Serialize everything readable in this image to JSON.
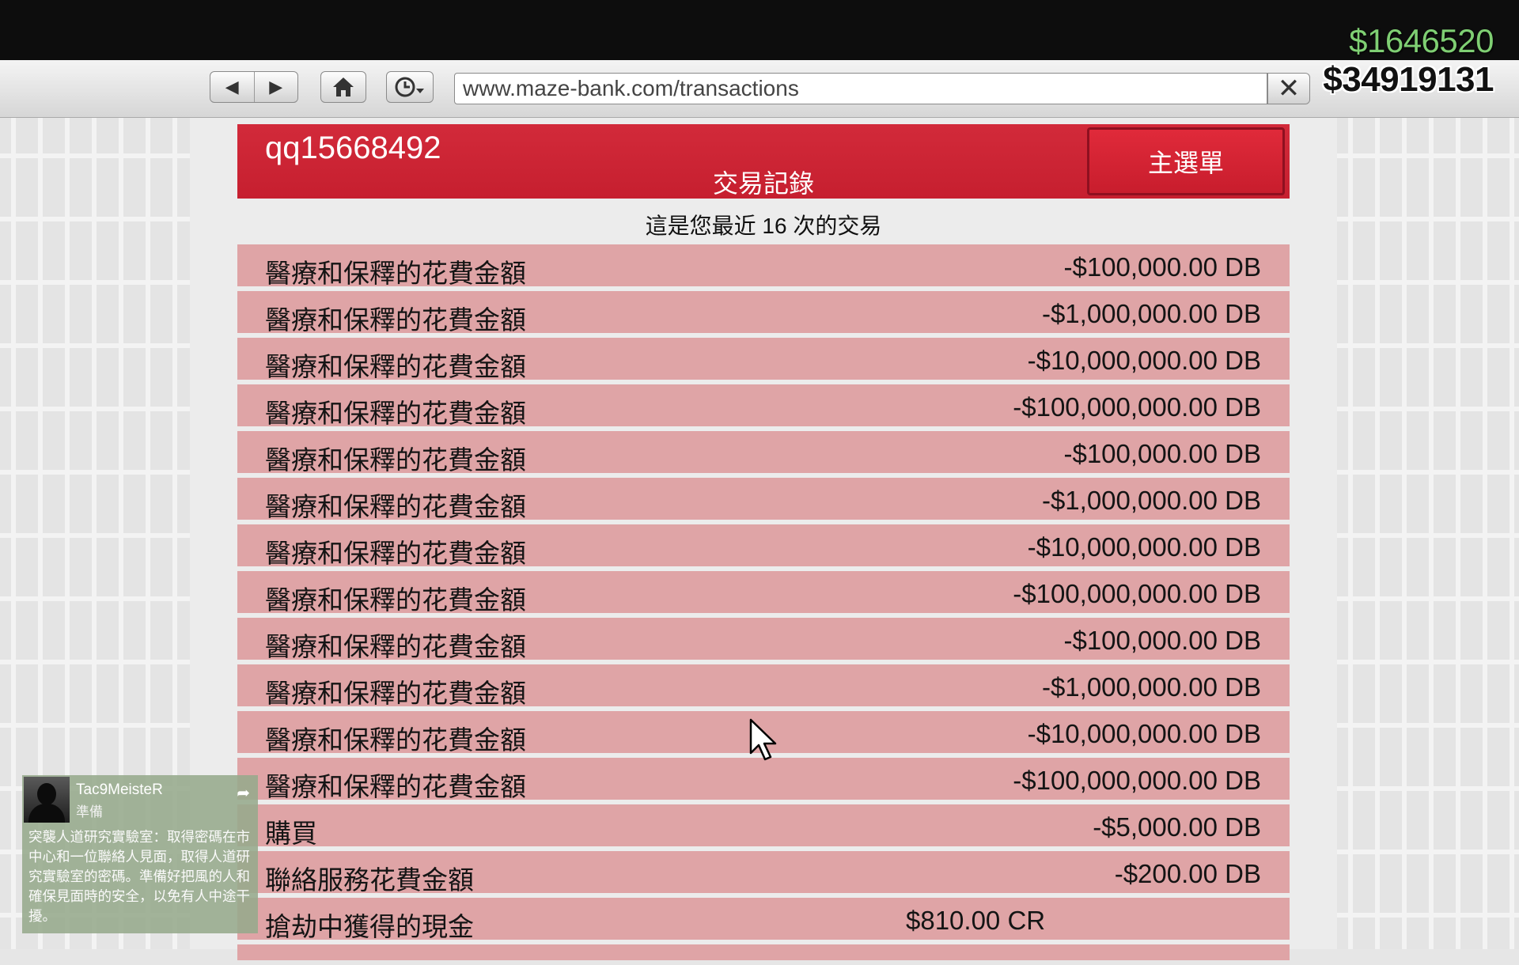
{
  "hud": {
    "cash": "$1646520",
    "bank": "$34919131"
  },
  "browser": {
    "url": "www.maze-bank.com/transactions",
    "back_glyph": "◀",
    "forward_glyph": "▶",
    "home_glyph": "⌂",
    "history_glyph": "🕓",
    "close_glyph": "✕"
  },
  "header": {
    "username": "qq15668492",
    "section_title": "交易記錄",
    "menu_label": "主選單"
  },
  "caption": "這是您最近 16 次的交易",
  "transactions": [
    {
      "desc": "醫療和保釋的花費金額",
      "amount": "-$100,000.00 DB"
    },
    {
      "desc": "醫療和保釋的花費金額",
      "amount": "-$1,000,000.00 DB"
    },
    {
      "desc": "醫療和保釋的花費金額",
      "amount": "-$10,000,000.00 DB"
    },
    {
      "desc": "醫療和保釋的花費金額",
      "amount": "-$100,000,000.00 DB"
    },
    {
      "desc": "醫療和保釋的花費金額",
      "amount": "-$100,000.00 DB"
    },
    {
      "desc": "醫療和保釋的花費金額",
      "amount": "-$1,000,000.00 DB"
    },
    {
      "desc": "醫療和保釋的花費金額",
      "amount": "-$10,000,000.00 DB"
    },
    {
      "desc": "醫療和保釋的花費金額",
      "amount": "-$100,000,000.00 DB"
    },
    {
      "desc": "醫療和保釋的花費金額",
      "amount": "-$100,000.00 DB"
    },
    {
      "desc": "醫療和保釋的花費金額",
      "amount": "-$1,000,000.00 DB"
    },
    {
      "desc": "醫療和保釋的花費金額",
      "amount": "-$10,000,000.00 DB"
    },
    {
      "desc": "醫療和保釋的花費金額",
      "amount": "-$100,000,000.00 DB"
    },
    {
      "desc": "購買",
      "amount": "-$5,000.00 DB"
    },
    {
      "desc": "聯絡服務花費金額",
      "amount": "-$200.00 DB"
    },
    {
      "desc": "搶劫中獲得的現金",
      "amount": "$810.00 CR"
    }
  ],
  "notification": {
    "player": "Tac9MeisteR",
    "status": "準備",
    "share_glyph": "➦",
    "message": "突襲人道研究實驗室：取得密碼在市中心和一位聯絡人見面，取得人道研究實驗室的密碼。準備好把風的人和確保見面時的安全，以免有人中途干擾。"
  },
  "colors": {
    "header_red": "#c8202f",
    "row_pink": "#dfa4a6",
    "cash_green": "#7fcf73"
  }
}
